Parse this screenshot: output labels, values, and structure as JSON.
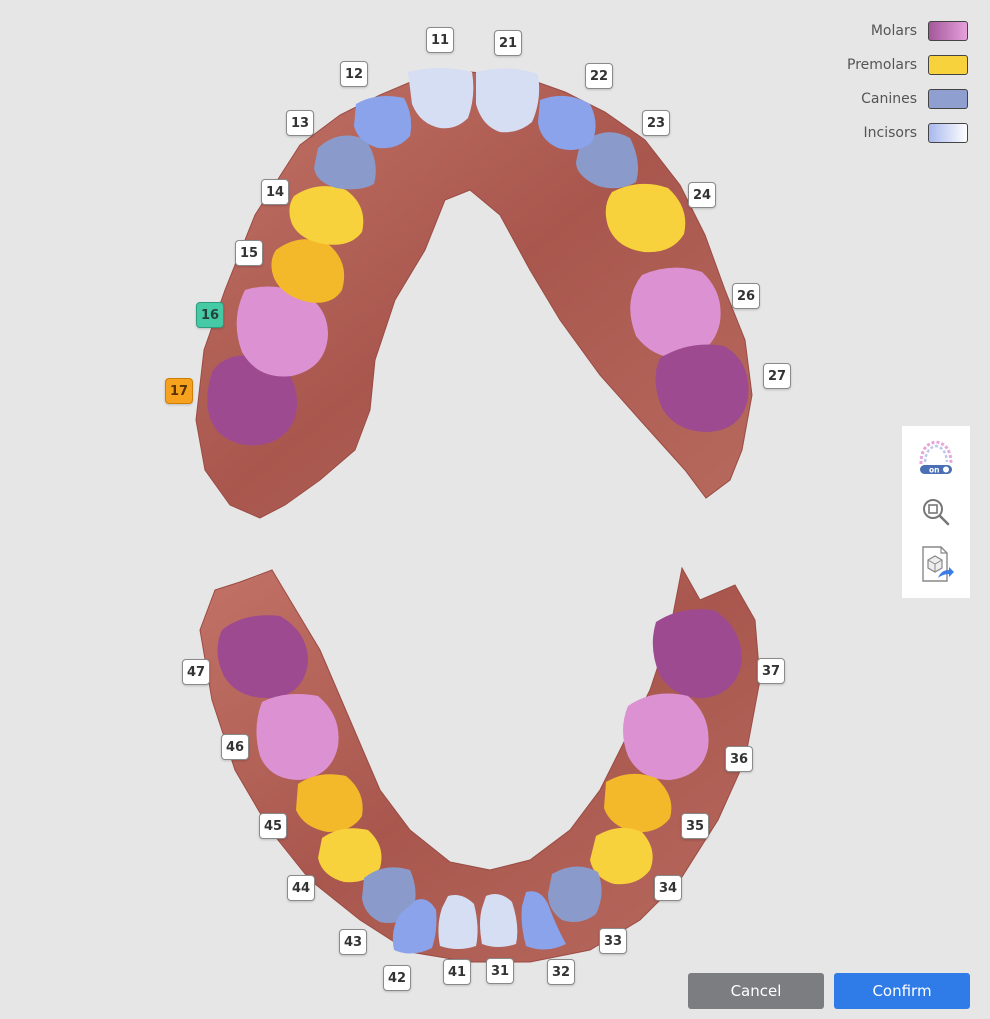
{
  "legend": [
    {
      "label": "Molars",
      "color_from": "#a3589a",
      "color_to": "#e6a0dc"
    },
    {
      "label": "Premolars",
      "color_from": "#f7d23c",
      "color_to": "#f7d23c"
    },
    {
      "label": "Canines",
      "color_from": "#8f9fd0",
      "color_to": "#8f9fd0"
    },
    {
      "label": "Incisors",
      "color_from": "#a8b8ee",
      "color_to": "#ffffff"
    }
  ],
  "upper_arch": {
    "labels": [
      "11",
      "21",
      "12",
      "22",
      "13",
      "23",
      "14",
      "24",
      "15",
      "16",
      "26",
      "17",
      "27"
    ],
    "selected": {
      "16": "green",
      "17": "orange"
    }
  },
  "lower_arch": {
    "labels": [
      "47",
      "37",
      "46",
      "36",
      "45",
      "35",
      "44",
      "34",
      "43",
      "33",
      "42",
      "41",
      "31",
      "32"
    ]
  },
  "toolbar": {
    "arch_toggle_icon": "arch-visibility-toggle-icon",
    "arch_toggle_text": "on",
    "zoom_fit_icon": "zoom-fit-icon",
    "export_icon": "export-model-icon"
  },
  "actions": {
    "cancel_label": "Cancel",
    "confirm_label": "Confirm"
  },
  "colors": {
    "background": "#e6e6e6",
    "gum": "#b05e53",
    "molar": "#9d4a90",
    "molar_light": "#dc92d2",
    "premolar": "#f7d23c",
    "premolar_dark": "#f4b92a",
    "canine": "#8a9bcb",
    "lateral_incisor": "#8aa3ea",
    "central_incisor": "#d6def4",
    "selected_green": "#46c9a5",
    "selected_orange": "#f6a21e",
    "confirm": "#2f7be8",
    "cancel": "#7c7d80"
  }
}
